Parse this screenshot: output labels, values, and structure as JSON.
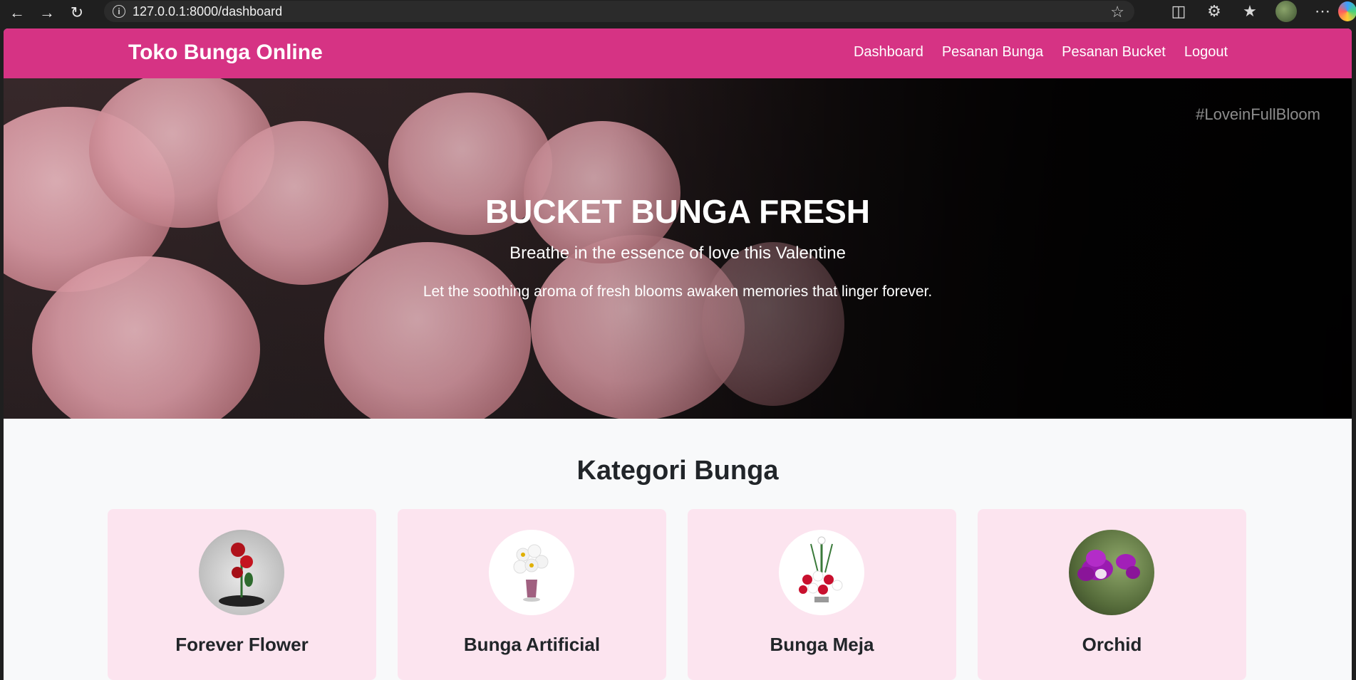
{
  "browser": {
    "url": "127.0.0.1:8000/dashboard",
    "icons": [
      "back-icon",
      "forward-icon",
      "reload-icon",
      "info-icon",
      "star-icon",
      "extensions-icon",
      "favorites-icon",
      "profile-avatar",
      "more-icon"
    ]
  },
  "navbar": {
    "brand": "Toko Bunga Online",
    "links": [
      "Dashboard",
      "Pesanan Bunga",
      "Pesanan Bucket",
      "Logout"
    ],
    "color": "#d63384"
  },
  "hero": {
    "tag": "#LoveinFullBloom",
    "title": "BUCKET BUNGA FRESH",
    "subtitle": "Breathe in the essence of love this Valentine",
    "description": "Let the soothing aroma of fresh blooms awaken memories that linger forever."
  },
  "categories": {
    "title": "Kategori Bunga",
    "items": [
      {
        "name": "Forever Flower"
      },
      {
        "name": "Bunga Artificial"
      },
      {
        "name": "Bunga Meja"
      },
      {
        "name": "Orchid"
      }
    ],
    "card_color": "#fce4ef"
  }
}
